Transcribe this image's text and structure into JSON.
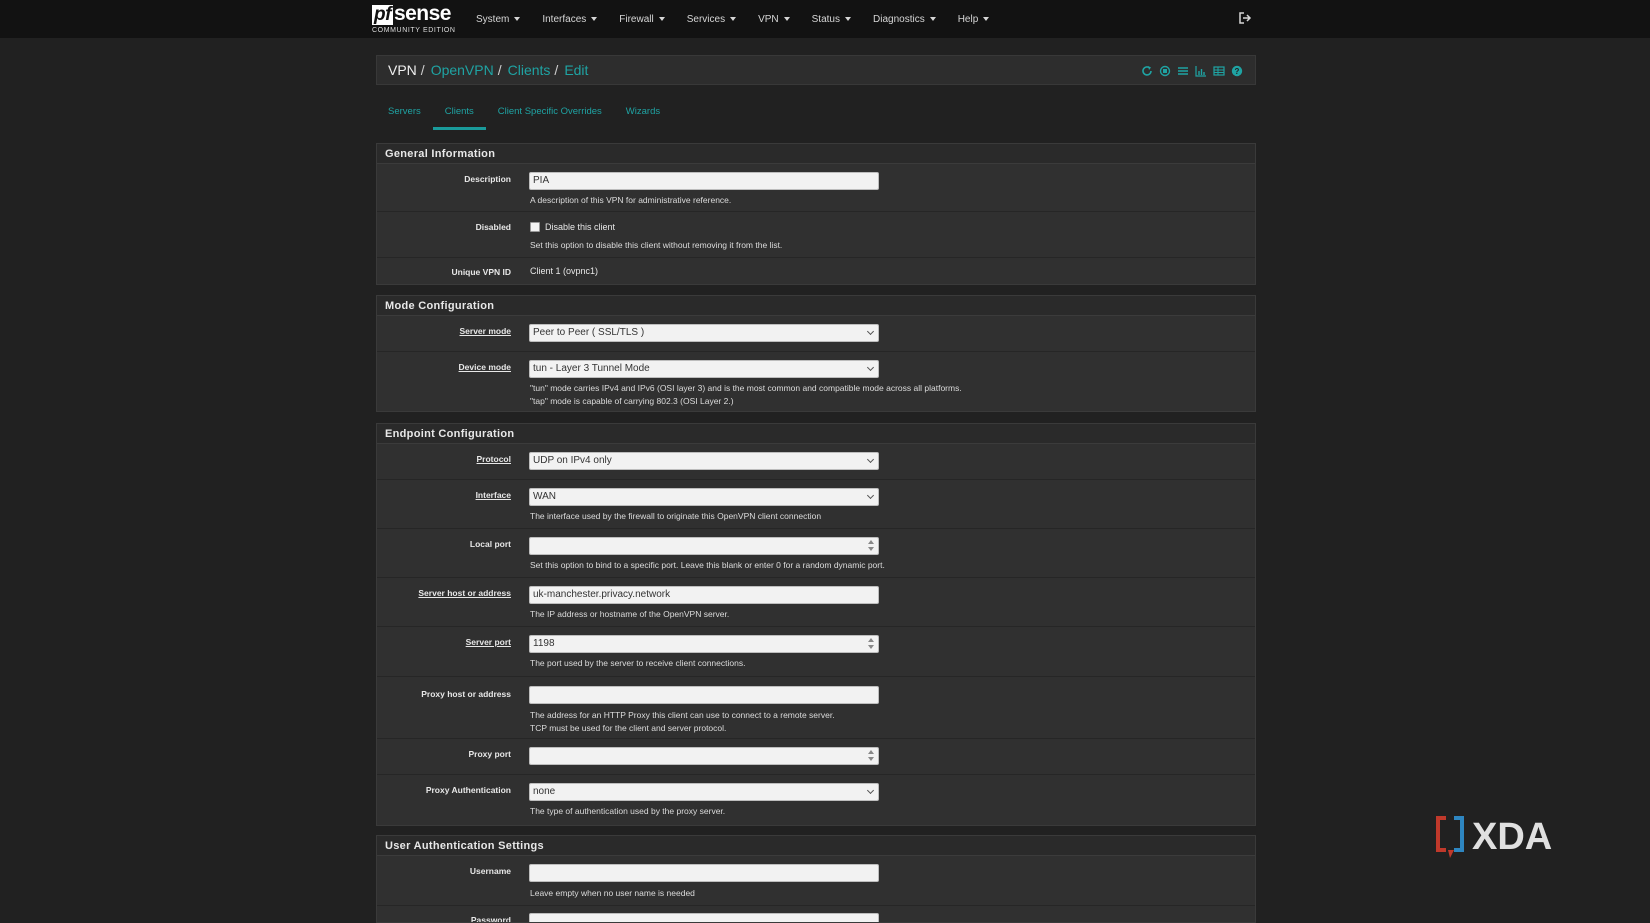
{
  "navbar": {
    "logo_pf": "pf",
    "logo_sense": "sense",
    "logo_edition": "COMMUNITY EDITION",
    "menu": [
      "System",
      "Interfaces",
      "Firewall",
      "Services",
      "VPN",
      "Status",
      "Diagnostics",
      "Help"
    ],
    "logout_icon": "logout-icon"
  },
  "breadcrumb": {
    "items": [
      "VPN",
      "OpenVPN",
      "Clients",
      "Edit"
    ],
    "icons": [
      "reload-icon",
      "stop-circle-icon",
      "list-icon",
      "bar-chart-icon",
      "table-icon",
      "help-icon"
    ]
  },
  "tabs": [
    {
      "label": "Servers",
      "active": false
    },
    {
      "label": "Clients",
      "active": true
    },
    {
      "label": "Client Specific Overrides",
      "active": false
    },
    {
      "label": "Wizards",
      "active": false
    }
  ],
  "sections": {
    "general": {
      "title": "General Information",
      "description_label": "Description",
      "description_value": "PIA",
      "description_help": "A description of this VPN for administrative reference.",
      "disabled_label": "Disabled",
      "disabled_checkbox": "Disable this client",
      "disabled_checked": false,
      "disabled_help": "Set this option to disable this client without removing it from the list.",
      "vpnid_label": "Unique VPN ID",
      "vpnid_value": "Client 1 (ovpnc1)"
    },
    "mode": {
      "title": "Mode Configuration",
      "server_mode_label": "Server mode",
      "server_mode_value": "Peer to Peer ( SSL/TLS )",
      "device_mode_label": "Device mode",
      "device_mode_value": "tun - Layer 3 Tunnel Mode",
      "device_mode_help_1": "\"tun\" mode carries IPv4 and IPv6 (OSI layer 3) and is the most common and compatible mode across all platforms.",
      "device_mode_help_2": "\"tap\" mode is capable of carrying 802.3 (OSI Layer 2.)"
    },
    "endpoint": {
      "title": "Endpoint Configuration",
      "protocol_label": "Protocol",
      "protocol_value": "UDP on IPv4 only",
      "interface_label": "Interface",
      "interface_value": "WAN",
      "interface_help": "The interface used by the firewall to originate this OpenVPN client connection",
      "local_port_label": "Local port",
      "local_port_value": "",
      "local_port_help": "Set this option to bind to a specific port. Leave this blank or enter 0 for a random dynamic port.",
      "server_host_label": "Server host or address",
      "server_host_value": "uk-manchester.privacy.network",
      "server_host_help": "The IP address or hostname of the OpenVPN server.",
      "server_port_label": "Server port",
      "server_port_value": "1198",
      "server_port_help": "The port used by the server to receive client connections.",
      "proxy_host_label": "Proxy host or address",
      "proxy_host_value": "",
      "proxy_host_help_1": "The address for an HTTP Proxy this client can use to connect to a remote server.",
      "proxy_host_help_2": "TCP must be used for the client and server protocol.",
      "proxy_port_label": "Proxy port",
      "proxy_port_value": "",
      "proxy_auth_label": "Proxy Authentication",
      "proxy_auth_value": "none",
      "proxy_auth_help": "The type of authentication used by the proxy server."
    },
    "userauth": {
      "title": "User Authentication Settings",
      "username_label": "Username",
      "username_value": "",
      "username_help": "Leave empty when no user name is needed",
      "password_label": "Password"
    }
  },
  "watermark": {
    "text": "XDA"
  },
  "colors": {
    "accent": "#1fa3a3",
    "navbar": "#121212",
    "background": "#212121",
    "panel": "#303030"
  }
}
